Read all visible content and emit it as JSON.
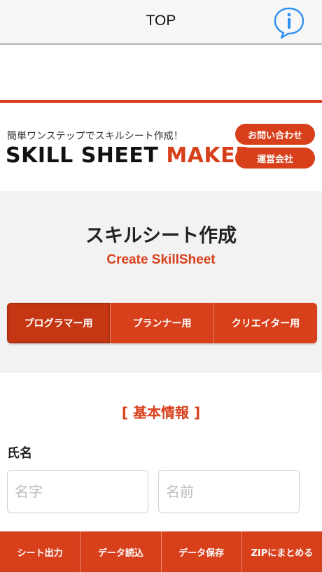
{
  "navbar": {
    "title": "TOP"
  },
  "header": {
    "tagline": "簡単ワンステップでスキルシート作成！",
    "brand_part1": "SKILL SHEET",
    "brand_part2": "MAKER",
    "contact_label": "お問い合わせ",
    "company_label": "運営会社"
  },
  "create": {
    "title": "スキルシート作成",
    "subtitle": "Create SkillSheet",
    "tabs": [
      {
        "label": "プログラマー用",
        "active": true
      },
      {
        "label": "プランナー用",
        "active": false
      },
      {
        "label": "クリエイター用",
        "active": false
      }
    ]
  },
  "basic_info": {
    "heading": "[ 基本情報 ]",
    "name_label": "氏名",
    "last_name_placeholder": "名字",
    "first_name_placeholder": "名前"
  },
  "bottom_bar": {
    "items": [
      "シート出力",
      "データ読込",
      "データ保存",
      "ZIPにまとめる"
    ]
  },
  "colors": {
    "accent": "#d8401c",
    "info_blue": "#2e8ff0"
  }
}
